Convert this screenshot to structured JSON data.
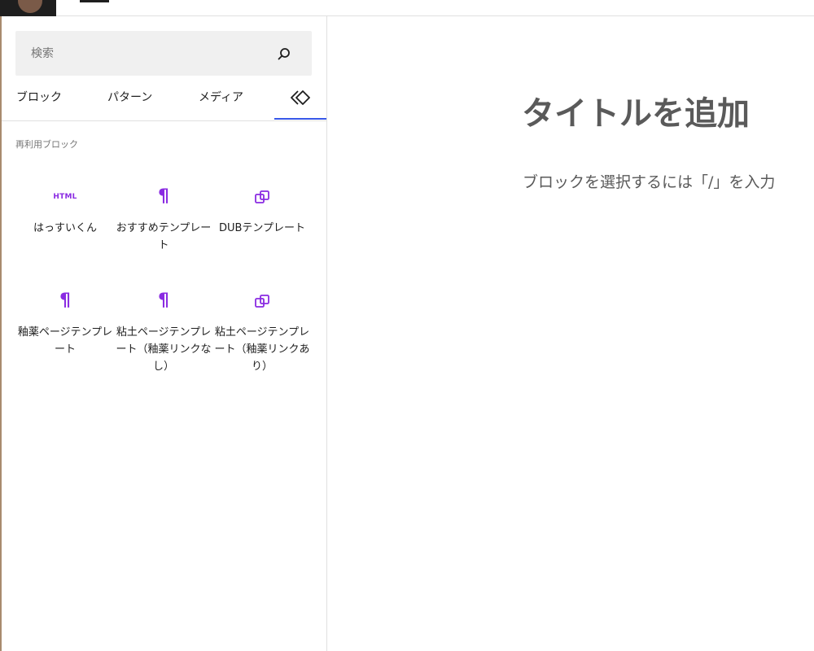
{
  "search": {
    "placeholder": "検索"
  },
  "tabs": [
    {
      "label": "ブロック"
    },
    {
      "label": "パターン"
    },
    {
      "label": "メディア"
    },
    {
      "icon": "reusable-block-icon",
      "active": true
    }
  ],
  "reusable": {
    "category_title": "再利用ブロック",
    "items": [
      {
        "icon": "html-icon",
        "icon_text": "HTML",
        "label": "はっすいくん"
      },
      {
        "icon": "paragraph-icon",
        "icon_text": "¶",
        "label": "おすすめテンプレート"
      },
      {
        "icon": "group-icon",
        "label": "DUBテンプレート"
      },
      {
        "icon": "paragraph-icon",
        "icon_text": "¶",
        "label": "釉薬ページテンプレート"
      },
      {
        "icon": "paragraph-icon",
        "icon_text": "¶",
        "label": "粘土ページテンプレート（釉薬リンクなし）"
      },
      {
        "icon": "group-icon",
        "label": "粘土ページテンプレート（釉薬リンクあり）"
      }
    ]
  },
  "editor": {
    "title_placeholder": "タイトルを追加",
    "block_placeholder": "ブロックを選択するには「/」を入力"
  },
  "colors": {
    "accent": "#3858e9",
    "block_icon": "#8a2be2",
    "muted_text": "#757575",
    "editor_text": "#5a5a5a"
  }
}
